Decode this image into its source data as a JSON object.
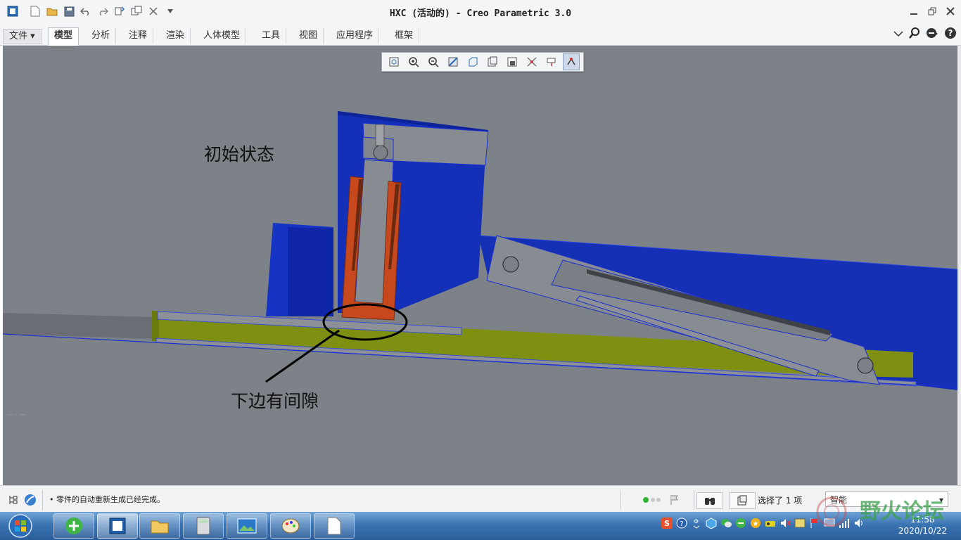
{
  "window": {
    "title": "HXC (活动的) - Creo Parametric 3.0"
  },
  "tabs": [
    {
      "label": "文件 ▾"
    },
    {
      "label": "模型"
    },
    {
      "label": "分析"
    },
    {
      "label": "注释"
    },
    {
      "label": "渲染"
    },
    {
      "label": "人体模型"
    },
    {
      "label": "工具"
    },
    {
      "label": "视图"
    },
    {
      "label": "应用程序"
    },
    {
      "label": "框架"
    }
  ],
  "active_tab": "模型",
  "annotations": {
    "initial_state": "初始状态",
    "gap_note": "下边有间隙"
  },
  "status": {
    "message": "零件的自动重新生成已经完成。",
    "selection": "选择了 1 项",
    "filter_value": "智能"
  },
  "taskbar": {
    "time": "11:58",
    "date": "2020/10/22"
  },
  "watermark": "野火论坛",
  "colors": {
    "viewport_bg": "#7d8289",
    "part_blue": "#1632b8",
    "part_olive": "#7e8e13",
    "part_orange": "#c8481e",
    "edge_blue": "#1a2fd0"
  }
}
